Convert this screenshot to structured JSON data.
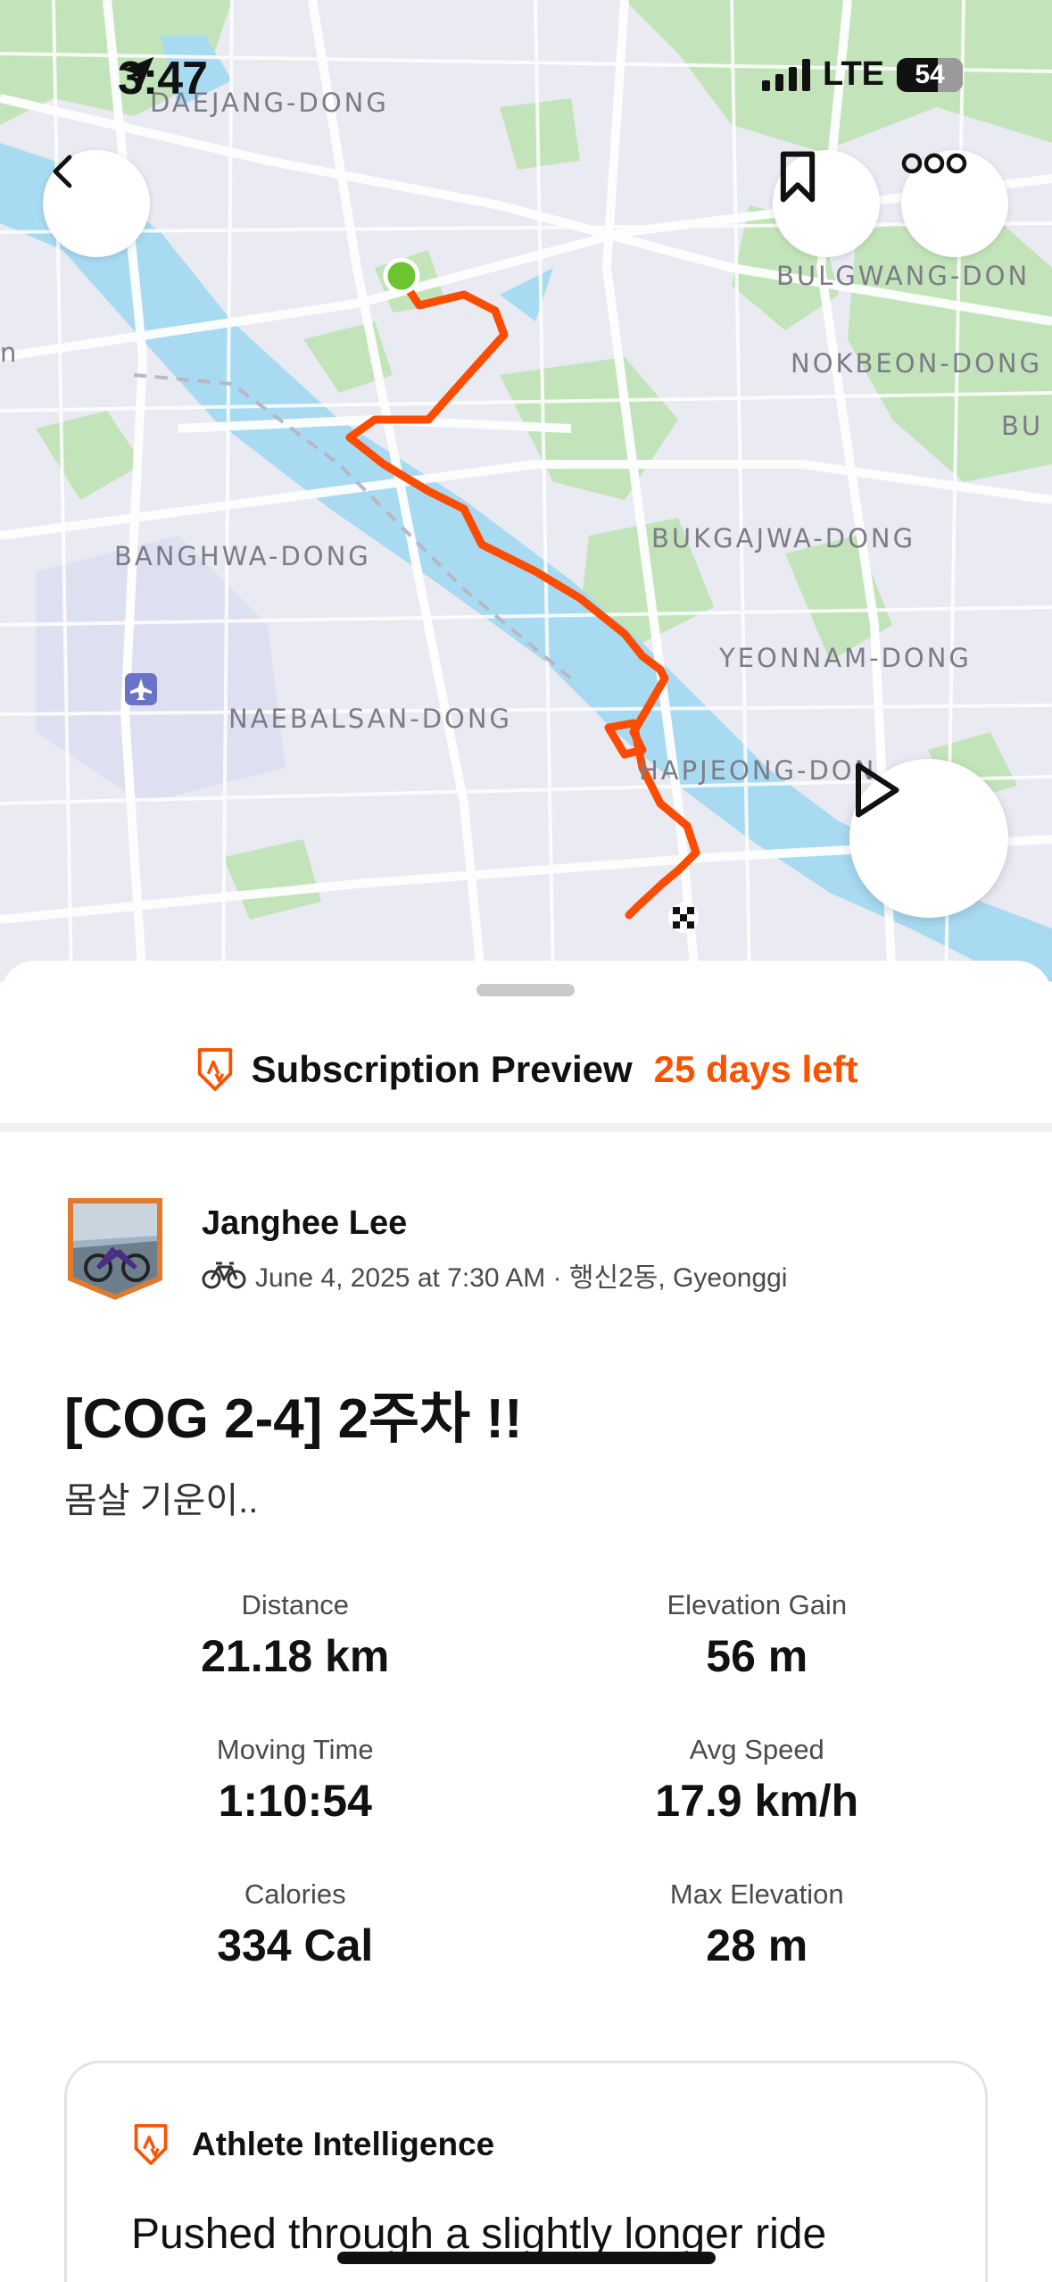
{
  "status_bar": {
    "time": "3:47",
    "network": "LTE",
    "battery": "54"
  },
  "map": {
    "labels": {
      "daejang": "DAEJANG-DONG",
      "bulgwang": "BULGWANG-DON",
      "nokbeon": "NOKBEON-DONG",
      "bu": "BU",
      "banghwa": "BANGHWA-DONG",
      "bukgajwa": "BUKGAJWA-DONG",
      "yeonnam": "YEONNAM-DONG",
      "naebalsan": "NAEBALSAN-DONG",
      "hapjeong": "HAPJEONG-DON",
      "left_edge": "n"
    },
    "route_color": "#fc4c02",
    "start_color": "#6cc430"
  },
  "promo": {
    "title": "Subscription Preview",
    "days_left": "25 days left"
  },
  "athlete": {
    "name": "Janghee Lee",
    "meta": "June 4, 2025 at 7:30 AM · 행신2동, Gyeonggi"
  },
  "activity": {
    "title": "[COG 2-4] 2주차 !!",
    "description": "몸살 기운이.."
  },
  "stats": [
    {
      "label": "Distance",
      "value": "21.18 km"
    },
    {
      "label": "Elevation Gain",
      "value": "56 m"
    },
    {
      "label": "Moving Time",
      "value": "1:10:54"
    },
    {
      "label": "Avg Speed",
      "value": "17.9 km/h"
    },
    {
      "label": "Calories",
      "value": "334 Cal"
    },
    {
      "label": "Max Elevation",
      "value": "28 m"
    }
  ],
  "athlete_intelligence": {
    "title": "Athlete Intelligence",
    "text": "Pushed through a slightly longer ride"
  },
  "colors": {
    "accent": "#fc5200",
    "text": "#111111",
    "muted": "#4a4a4f"
  }
}
